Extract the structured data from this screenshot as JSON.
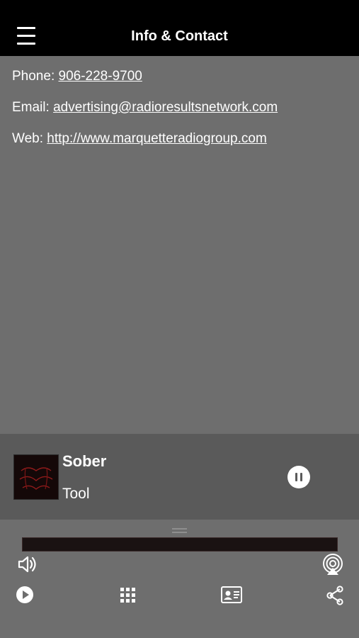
{
  "header": {
    "title": "Info & Contact",
    "menu_icon": "hamburger-menu-icon"
  },
  "contact": {
    "phone_label": "Phone:",
    "phone_value": "906-228-9700",
    "email_label": "Email:",
    "email_value": "advertising@radioresultsnetwork.com",
    "web_label": "Web:",
    "web_value": "http://www.marquetteradiogroup.com"
  },
  "now_playing": {
    "title": "Sober",
    "artist": "Tool",
    "state_icon": "pause-icon"
  },
  "toolbar": {
    "volume_icon": "volume-icon",
    "airplay_icon": "airplay-icon",
    "play_icon": "play-icon",
    "grid_icon": "grid-icon",
    "contact_card_icon": "contact-card-icon",
    "share_icon": "share-icon"
  },
  "colors": {
    "header_bg": "#000000",
    "page_bg": "#6e6e6e",
    "player_bg": "#5a5a5a",
    "text": "#ffffff"
  }
}
